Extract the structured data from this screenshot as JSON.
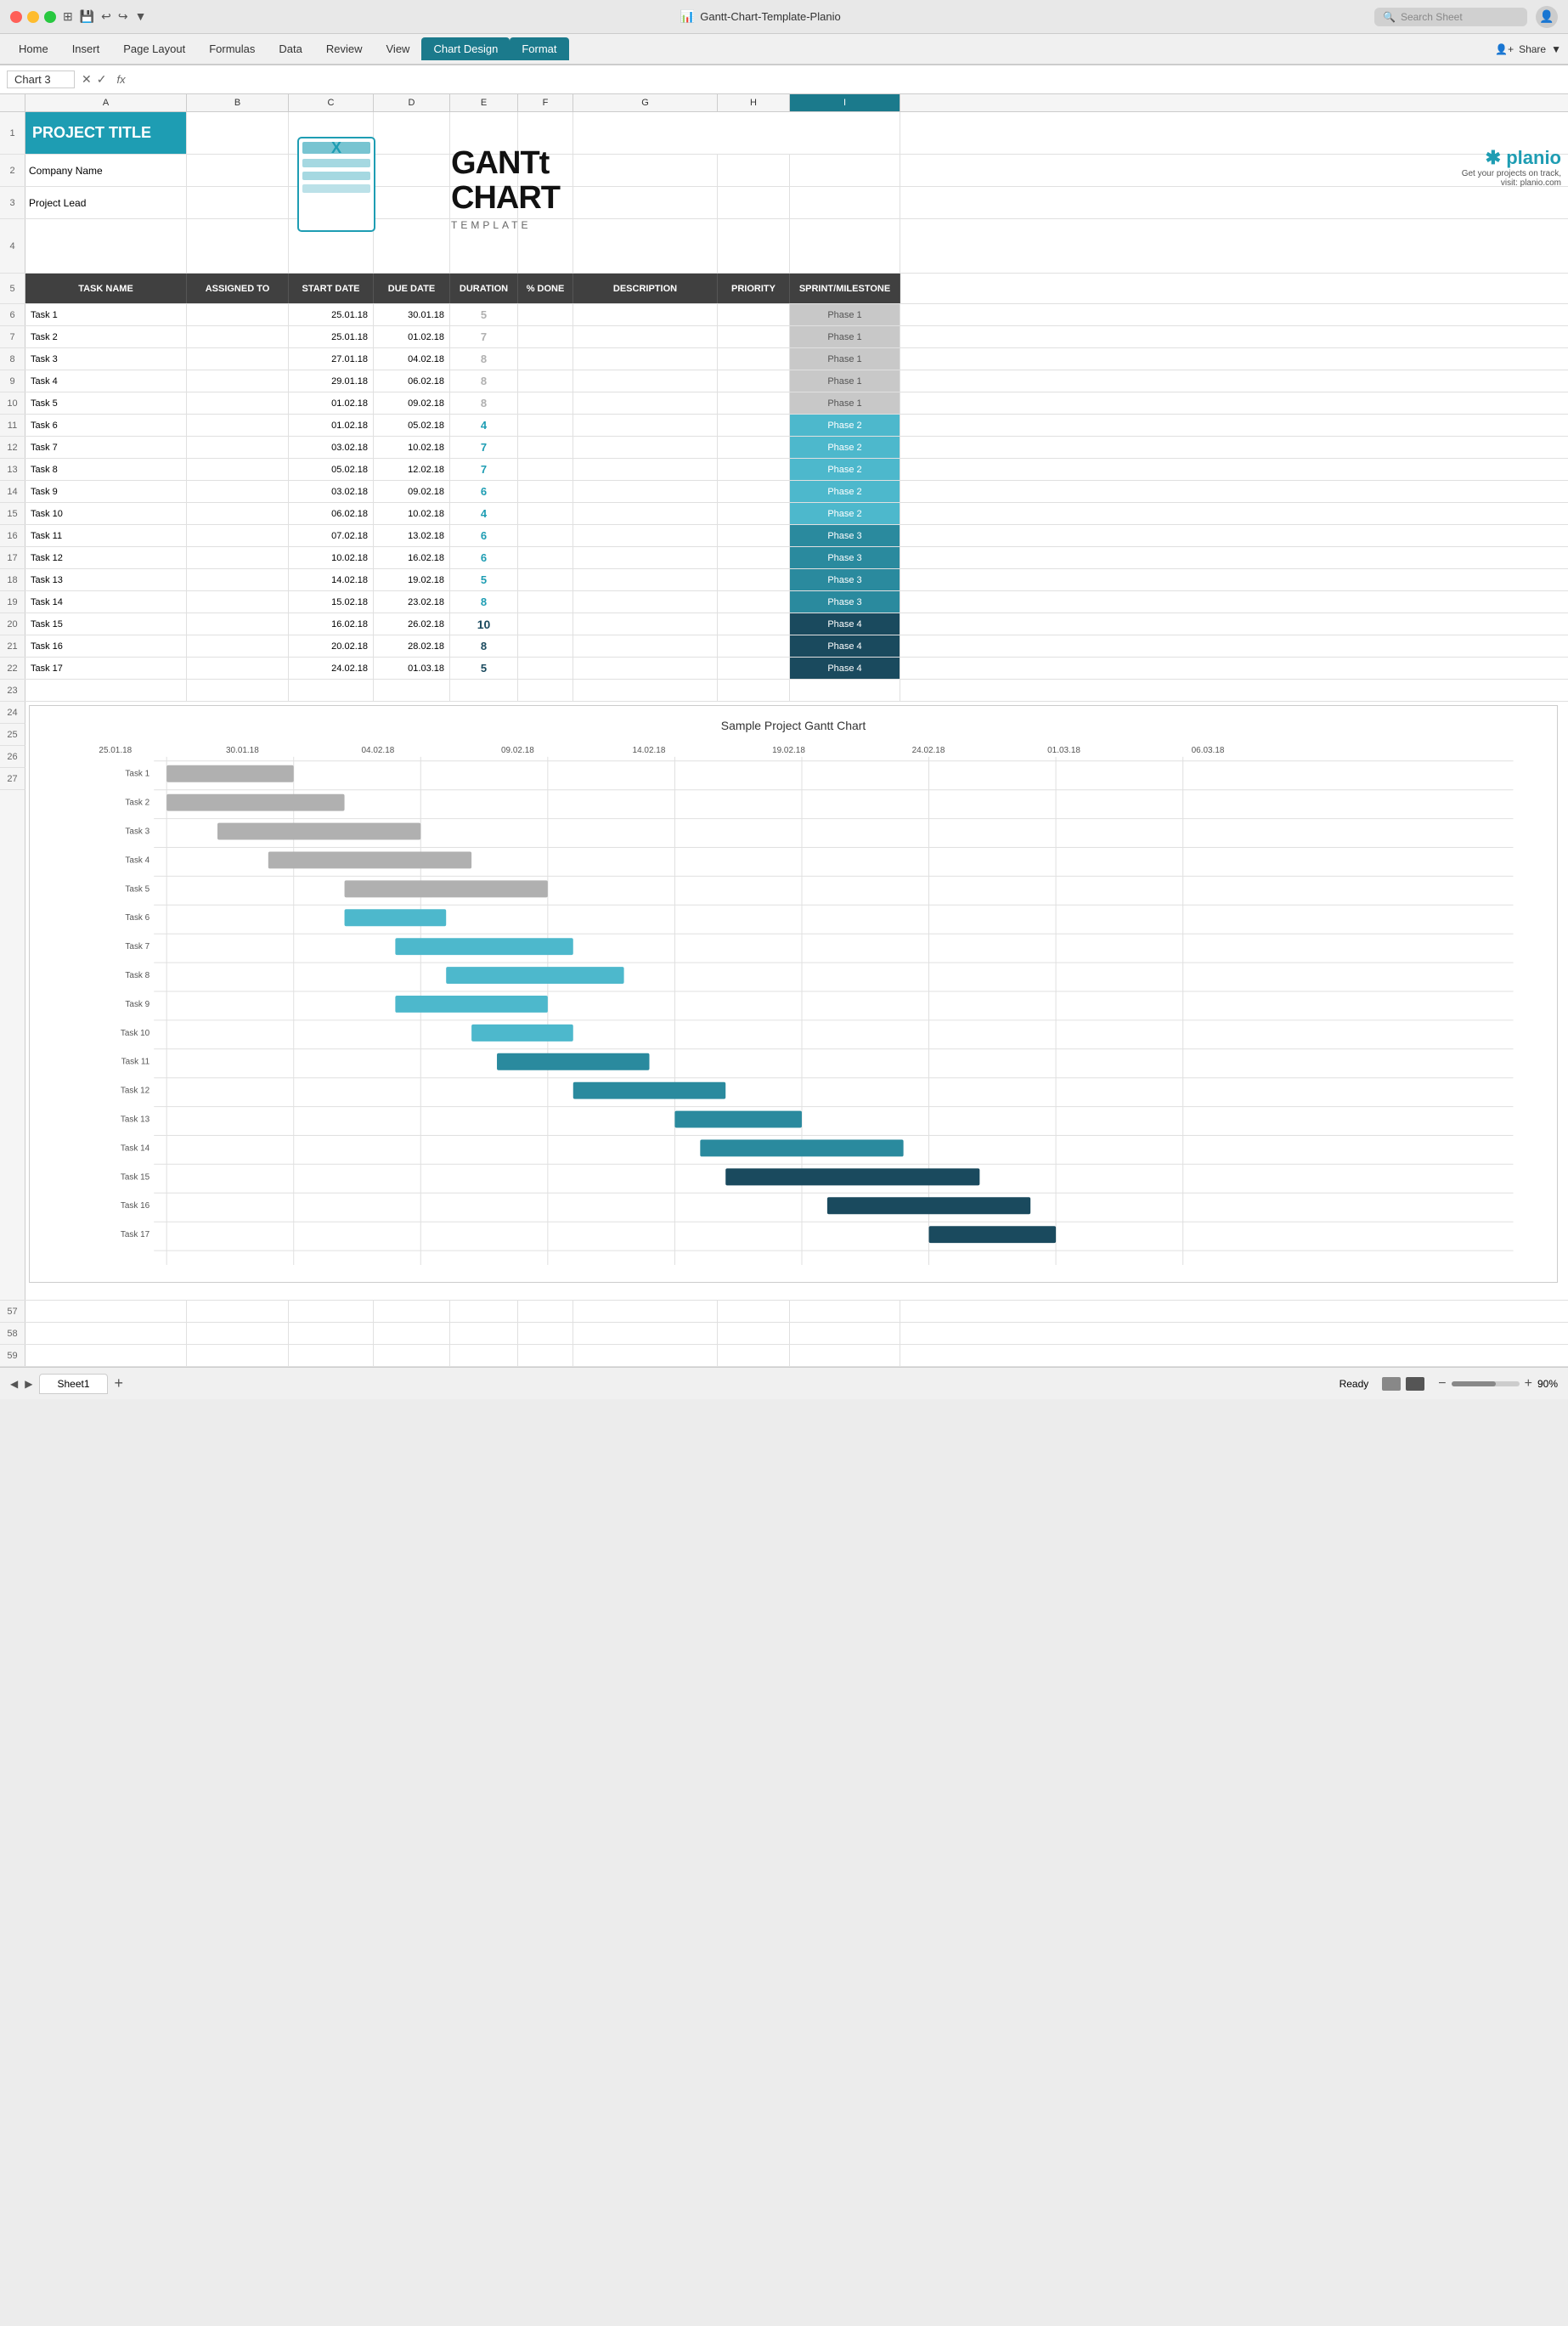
{
  "titleBar": {
    "filename": "Gantt-Chart-Template-Planio",
    "search_placeholder": "Search Sheet"
  },
  "ribbonTabs": [
    {
      "label": "Home",
      "active": false
    },
    {
      "label": "Insert",
      "active": false
    },
    {
      "label": "Page Layout",
      "active": false
    },
    {
      "label": "Formulas",
      "active": false
    },
    {
      "label": "Data",
      "active": false
    },
    {
      "label": "Review",
      "active": false
    },
    {
      "label": "View",
      "active": false
    },
    {
      "label": "Chart Design",
      "active": true
    },
    {
      "label": "Format",
      "active": true
    }
  ],
  "formulaBar": {
    "cellRef": "Chart 3",
    "formula": ""
  },
  "columns": [
    "A",
    "B",
    "C",
    "D",
    "E",
    "F",
    "G",
    "H",
    "I"
  ],
  "projectTitle": "PROJECT TITLE",
  "companyName": "Company Name",
  "projectLead": "Project Lead",
  "tableHeaders": {
    "taskName": "TASK NAME",
    "assignedTo": "ASSIGNED TO",
    "startDate": "START DATE",
    "dueDate": "DUE DATE",
    "duration": "DURATION",
    "percentDone": "% DONE",
    "description": "DESCRIPTION",
    "priority": "PRIORITY",
    "sprint": "SPRINT/MILESTONE"
  },
  "tasks": [
    {
      "row": 6,
      "name": "Task 1",
      "assignedTo": "",
      "startDate": "25.01.18",
      "dueDate": "30.01.18",
      "duration": "5",
      "percentDone": "",
      "description": "",
      "priority": "",
      "sprint": "Phase 1",
      "phaseClass": "phase-1"
    },
    {
      "row": 7,
      "name": "Task 2",
      "assignedTo": "",
      "startDate": "25.01.18",
      "dueDate": "01.02.18",
      "duration": "7",
      "percentDone": "",
      "description": "",
      "priority": "",
      "sprint": "Phase 1",
      "phaseClass": "phase-1"
    },
    {
      "row": 8,
      "name": "Task 3",
      "assignedTo": "",
      "startDate": "27.01.18",
      "dueDate": "04.02.18",
      "duration": "8",
      "percentDone": "",
      "description": "",
      "priority": "",
      "sprint": "Phase 1",
      "phaseClass": "phase-1"
    },
    {
      "row": 9,
      "name": "Task 4",
      "assignedTo": "",
      "startDate": "29.01.18",
      "dueDate": "06.02.18",
      "duration": "8",
      "percentDone": "",
      "description": "",
      "priority": "",
      "sprint": "Phase 1",
      "phaseClass": "phase-1"
    },
    {
      "row": 10,
      "name": "Task 5",
      "assignedTo": "",
      "startDate": "01.02.18",
      "dueDate": "09.02.18",
      "duration": "8",
      "percentDone": "",
      "description": "",
      "priority": "",
      "sprint": "Phase 1",
      "phaseClass": "phase-1"
    },
    {
      "row": 11,
      "name": "Task 6",
      "assignedTo": "",
      "startDate": "01.02.18",
      "dueDate": "05.02.18",
      "duration": "4",
      "percentDone": "",
      "description": "",
      "priority": "",
      "sprint": "Phase 2",
      "phaseClass": "phase-2"
    },
    {
      "row": 12,
      "name": "Task 7",
      "assignedTo": "",
      "startDate": "03.02.18",
      "dueDate": "10.02.18",
      "duration": "7",
      "percentDone": "",
      "description": "",
      "priority": "",
      "sprint": "Phase 2",
      "phaseClass": "phase-2"
    },
    {
      "row": 13,
      "name": "Task 8",
      "assignedTo": "",
      "startDate": "05.02.18",
      "dueDate": "12.02.18",
      "duration": "7",
      "percentDone": "",
      "description": "",
      "priority": "",
      "sprint": "Phase 2",
      "phaseClass": "phase-2"
    },
    {
      "row": 14,
      "name": "Task 9",
      "assignedTo": "",
      "startDate": "03.02.18",
      "dueDate": "09.02.18",
      "duration": "6",
      "percentDone": "",
      "description": "",
      "priority": "",
      "sprint": "Phase 2",
      "phaseClass": "phase-2"
    },
    {
      "row": 15,
      "name": "Task 10",
      "assignedTo": "",
      "startDate": "06.02.18",
      "dueDate": "10.02.18",
      "duration": "4",
      "percentDone": "",
      "description": "",
      "priority": "",
      "sprint": "Phase 2",
      "phaseClass": "phase-2"
    },
    {
      "row": 16,
      "name": "Task 11",
      "assignedTo": "",
      "startDate": "07.02.18",
      "dueDate": "13.02.18",
      "duration": "6",
      "percentDone": "",
      "description": "",
      "priority": "",
      "sprint": "Phase 3",
      "phaseClass": "phase-3"
    },
    {
      "row": 17,
      "name": "Task 12",
      "assignedTo": "",
      "startDate": "10.02.18",
      "dueDate": "16.02.18",
      "duration": "6",
      "percentDone": "",
      "description": "",
      "priority": "",
      "sprint": "Phase 3",
      "phaseClass": "phase-3"
    },
    {
      "row": 18,
      "name": "Task 13",
      "assignedTo": "",
      "startDate": "14.02.18",
      "dueDate": "19.02.18",
      "duration": "5",
      "percentDone": "",
      "description": "",
      "priority": "",
      "sprint": "Phase 3",
      "phaseClass": "phase-3"
    },
    {
      "row": 19,
      "name": "Task 14",
      "assignedTo": "",
      "startDate": "15.02.18",
      "dueDate": "23.02.18",
      "duration": "8",
      "percentDone": "",
      "description": "",
      "priority": "",
      "sprint": "Phase 3",
      "phaseClass": "phase-3"
    },
    {
      "row": 20,
      "name": "Task 15",
      "assignedTo": "",
      "startDate": "16.02.18",
      "dueDate": "26.02.18",
      "duration": "10",
      "percentDone": "",
      "description": "",
      "priority": "",
      "sprint": "Phase 4",
      "phaseClass": "phase-4"
    },
    {
      "row": 21,
      "name": "Task 16",
      "assignedTo": "",
      "startDate": "20.02.18",
      "dueDate": "28.02.18",
      "duration": "8",
      "percentDone": "",
      "description": "",
      "priority": "",
      "sprint": "Phase 4",
      "phaseClass": "phase-4"
    },
    {
      "row": 22,
      "name": "Task 17",
      "assignedTo": "",
      "startDate": "24.02.18",
      "dueDate": "01.03.18",
      "duration": "5",
      "percentDone": "",
      "description": "",
      "priority": "",
      "sprint": "Phase 4",
      "phaseClass": "phase-4"
    }
  ],
  "chart": {
    "title": "Sample Project Gantt Chart",
    "dateLabels": [
      "25.01.18",
      "30.01.18",
      "04.02.18",
      "09.02.18",
      "14.02.18",
      "19.02.18",
      "24.02.18",
      "01.03.18",
      "06.03.18"
    ]
  },
  "bottomBar": {
    "status": "Ready",
    "sheetName": "Sheet1",
    "zoom": "90%"
  },
  "planio": {
    "logo": "✱ planio",
    "tagline": "Get your projects on track,",
    "url": "visit: planio.com"
  }
}
